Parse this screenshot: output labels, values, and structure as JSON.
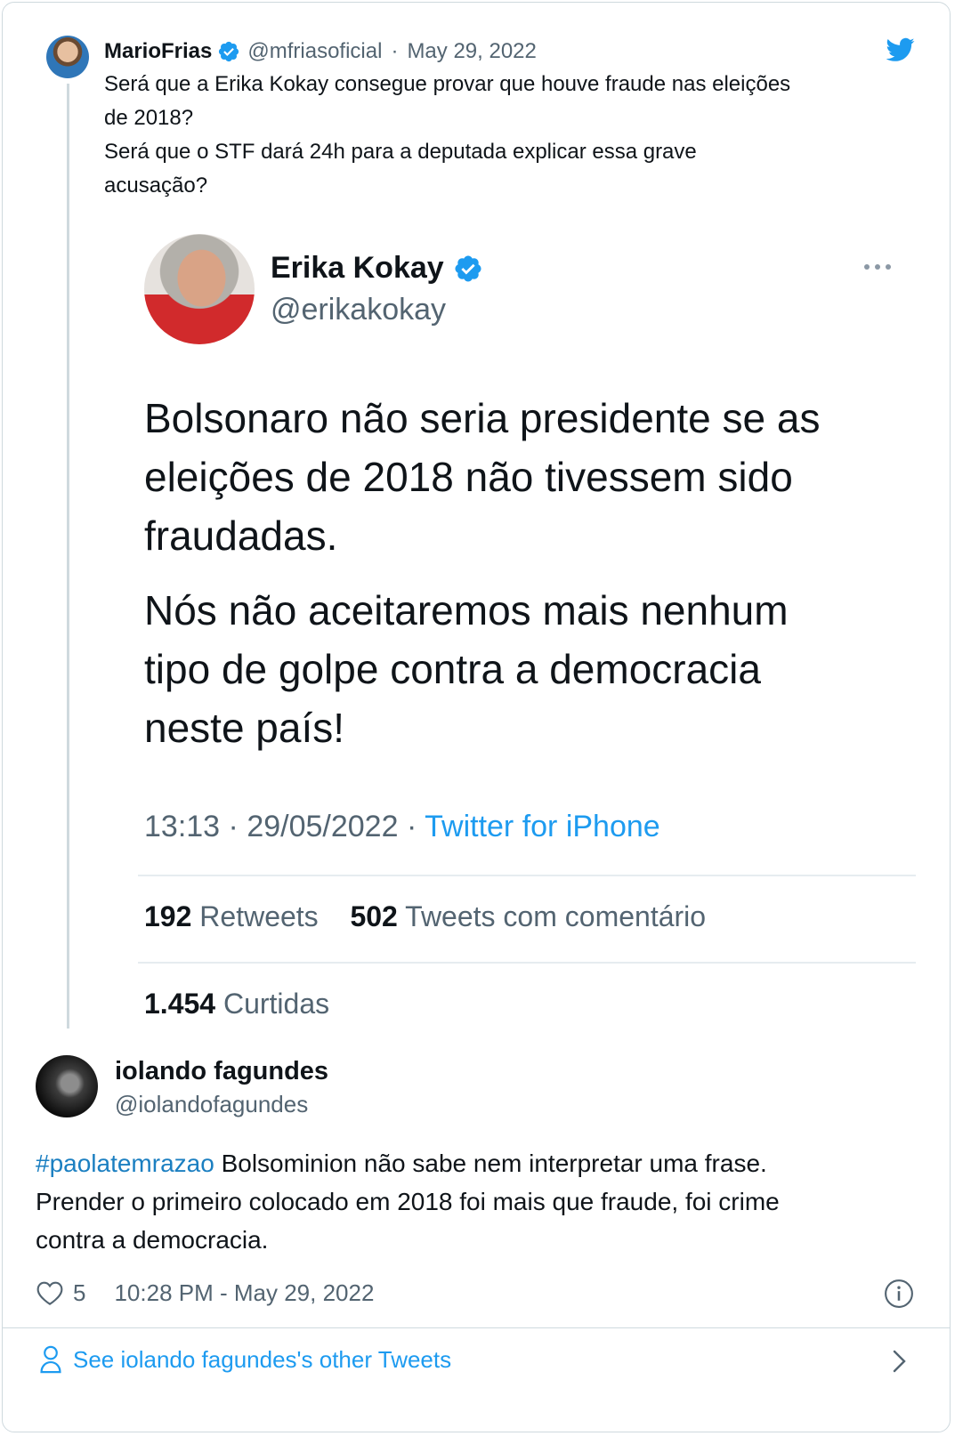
{
  "colors": {
    "link": "#1d9bf0",
    "hashtag": "#1b7fc1",
    "muted": "#536471",
    "text": "#0f1419",
    "border": "#cfd9de"
  },
  "parent_tweet": {
    "name": "MarioFrias",
    "handle": "@mfriasoficial",
    "separator": "·",
    "date": "May 29, 2022",
    "text_lines": [
      "Será que a Erika Kokay consegue provar que houve fraude nas eleições",
      "de 2018?",
      "Será que o STF dará 24h para a deputada explicar essa grave",
      "acusação?"
    ],
    "icons": [
      "avatar",
      "verified-badge-icon",
      "twitter-bird-icon"
    ]
  },
  "embedded_screenshot": {
    "name": "Erika Kokay",
    "handle": "@erikakokay",
    "paragraph_1_lines": [
      "Bolsonaro não seria presidente se as",
      "eleições de 2018 não tivessem sido",
      "fraudadas."
    ],
    "paragraph_2_lines": [
      "Nós não aceitaremos mais nenhum",
      "tipo de golpe contra a democracia",
      "neste país!"
    ],
    "time": "13:13",
    "meta_separator": "·",
    "date": "29/05/2022",
    "source": "Twitter for iPhone",
    "retweets_count": "192",
    "retweets_label": "Retweets",
    "quotes_count": "502",
    "quotes_label": "Tweets com comentário",
    "likes_count": "1.454",
    "likes_label": "Curtidas"
  },
  "reply_tweet": {
    "name": "iolando fagundes",
    "handle": "@iolandofagundes",
    "hashtag": "#paolatemrazao",
    "text_after_hashtag": " Bolsominion não sabe nem interpretar uma frase.",
    "text_lines": [
      "Prender o primeiro colocado em 2018 foi mais que fraude, foi crime",
      "contra a democracia."
    ],
    "like_count": "5",
    "timestamp": "10:28 PM - May 29, 2022"
  },
  "footer": {
    "see_more_label": "See iolando fagundes's other Tweets"
  }
}
